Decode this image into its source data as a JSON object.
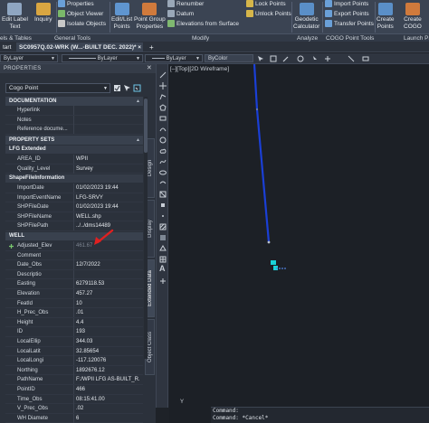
{
  "ribbon": {
    "commands": {
      "edit_label_text": "Edit Label\nText",
      "inquiry": "Inquiry",
      "properties": "Properties",
      "object_viewer": "Object Viewer",
      "isolate_objects": "Isolate Objects",
      "edit_list_points": "Edit/List\nPoints",
      "point_group_properties": "Point Group\nProperties",
      "renumber": "Renumber",
      "datum": "Datum",
      "elevations_from_surface": "Elevations from Surface",
      "lock_points": "Lock Points",
      "unlock_points": "Unlock Points",
      "geodetic_calculator": "Geodetic\nCalculator",
      "import_points": "Import Points",
      "export_points": "Export Points",
      "transfer_points": "Transfer Points",
      "create_points": "Create\nPoints",
      "create_cogo_points": "Create\nCOGO"
    },
    "footer": {
      "labels_tables": "els & Tables",
      "general_tools": "General Tools",
      "modify": "Modify",
      "analyze": "Analyze",
      "cogo_point_tools": "COGO Point Tools",
      "launch_pad": "Launch Pa"
    }
  },
  "tabs": {
    "start": "tart",
    "active": "SC0957Q.02-WRK (W...-BUILT DEC. 2022)*",
    "close": "×",
    "add": "+"
  },
  "toolbar": {
    "linetype": "ByLayer",
    "lineweight": "ByLayer",
    "layer": "ByLayer",
    "color": "ByColor"
  },
  "palette": {
    "title": "PROPERTIES",
    "close": "✕",
    "object_type": "Cogo Point",
    "side_tabs": [
      "Design",
      "Display",
      "Extended Data",
      "Object Class"
    ],
    "sections": {
      "documentation": {
        "title": "DOCUMENTATION",
        "rows": [
          {
            "key": "Hyperlink",
            "value": ""
          },
          {
            "key": "Notes",
            "value": ""
          },
          {
            "key": "Reference docume...",
            "value": ""
          }
        ]
      },
      "property_sets": {
        "title": "PROPERTY SETS",
        "lfg_title": "LFG Extended",
        "lfg_rows": [
          {
            "key": "AREA_ID",
            "value": "WPII"
          },
          {
            "key": "Quality_Level",
            "value": "Survey"
          }
        ],
        "shape_title": "ShapeFileInformation",
        "shape_rows": [
          {
            "key": "ImportDate",
            "value": "01/02/2023 19:44"
          },
          {
            "key": "ImportEventName",
            "value": "LFG-SRVY"
          },
          {
            "key": "SHPFileDate",
            "value": "01/02/2023 19:44"
          },
          {
            "key": "SHPFileName",
            "value": "WELL.shp"
          },
          {
            "key": "SHPFilePath",
            "value": "../../dms14489"
          }
        ]
      },
      "well": {
        "title": "WELL",
        "rows": [
          {
            "key": "Adjusted_Elev",
            "value": "461.67",
            "dim": true,
            "marked": true
          },
          {
            "key": "Comment",
            "value": ""
          },
          {
            "key": "Date_Obs",
            "value": "12/7/2022"
          },
          {
            "key": "Descriptio",
            "value": ""
          },
          {
            "key": "Easting",
            "value": "6279118.53"
          },
          {
            "key": "Elevation",
            "value": "457.27"
          },
          {
            "key": "FeatId",
            "value": "10"
          },
          {
            "key": "H_Prec_Obs",
            "value": ".01"
          },
          {
            "key": "Height",
            "value": "4.4"
          },
          {
            "key": "ID",
            "value": "193"
          },
          {
            "key": "LocalEllip",
            "value": "344.03"
          },
          {
            "key": "LocalLatit",
            "value": "32.85654"
          },
          {
            "key": "LocalLongi",
            "value": "-117.120076"
          },
          {
            "key": "Northing",
            "value": "1892676.12"
          },
          {
            "key": "PathName",
            "value": "F:/WPII LFG AS-BUILT_R..."
          },
          {
            "key": "PointID",
            "value": "466"
          },
          {
            "key": "Time_Obs",
            "value": "08:15:41.00"
          },
          {
            "key": "V_Prec_Obs",
            "value": ".02"
          },
          {
            "key": "WH Diamete",
            "value": "6"
          }
        ]
      }
    }
  },
  "canvas": {
    "viewport_label": "[–][Top][2D Wireframe]",
    "ucs_y": "Y",
    "command_lines": [
      "Command:",
      "Command: *Cancel*"
    ]
  },
  "colors": {
    "polyline": "#1a3fd6",
    "point_marker": "#19d3d8",
    "annotation_arrow": "#e02020"
  }
}
